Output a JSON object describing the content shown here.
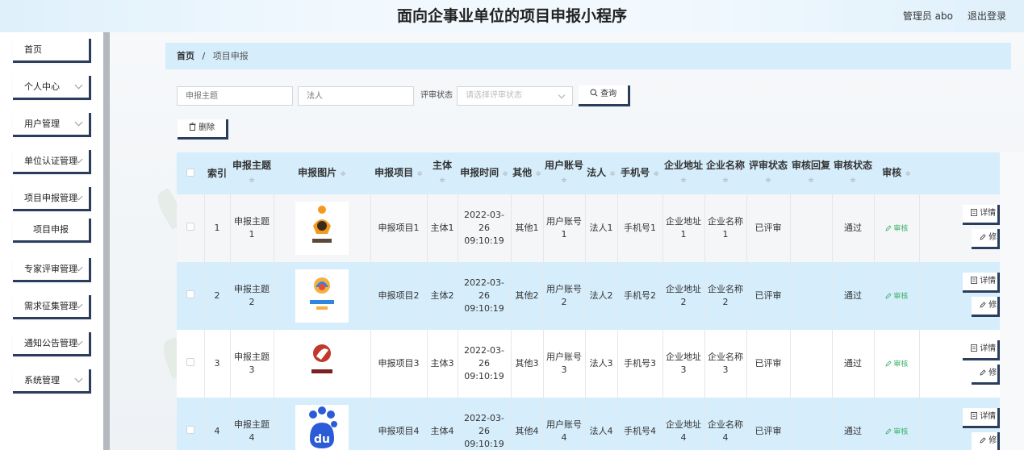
{
  "header": {
    "title": "面向企事业单位的项目申报小程序",
    "user": "管理员 abo",
    "logout": "退出登录"
  },
  "sidebar": {
    "items": [
      {
        "label": "首页",
        "has_chevron": false
      },
      {
        "label": "个人中心",
        "has_chevron": true
      },
      {
        "label": "用户管理",
        "has_chevron": true
      },
      {
        "label": "单位认证管理",
        "has_chevron": true
      },
      {
        "label": "项目申报管理",
        "has_chevron": true
      },
      {
        "label": "项目申报",
        "has_chevron": false,
        "sub": true
      },
      {
        "label": "专家评审管理",
        "has_chevron": true
      },
      {
        "label": "需求征集管理",
        "has_chevron": true
      },
      {
        "label": "通知公告管理",
        "has_chevron": true
      },
      {
        "label": "系统管理",
        "has_chevron": true
      }
    ]
  },
  "breadcrumb": {
    "home": "首页",
    "separator": "/",
    "current": "项目申报"
  },
  "filters": {
    "subject_placeholder": "申报主题",
    "legal_placeholder": "法人",
    "status_label": "评审状态",
    "status_placeholder": "请选择评审状态",
    "search_button": "查询"
  },
  "toolbar": {
    "delete_button": "删除"
  },
  "table": {
    "headers": {
      "index": "索引",
      "subject": "申报主题",
      "image": "申报图片",
      "project": "申报项目",
      "body": "主体",
      "time": "申报时间",
      "other": "其他",
      "account": "用户账号",
      "legal": "法人",
      "phone": "手机号",
      "address": "企业地址",
      "company": "企业名称",
      "review_status": "评审状态",
      "audit_reply": "审核回复",
      "audit_status": "审核状态",
      "audit": "审核"
    },
    "rows": [
      {
        "index": "1",
        "subject": "申报主题1",
        "project": "申报项目1",
        "body": "主体1",
        "time": "2022-03-26 09:10:19",
        "other": "其他1",
        "account": "用户账号1",
        "legal": "法人1",
        "phone": "手机号1",
        "address": "企业地址1",
        "company": "企业名称1",
        "review_status": "已评审",
        "audit_reply": "",
        "audit_status": "通过",
        "audit_link": "审核",
        "detail": "详情",
        "edit": "修改",
        "logo": "orange"
      },
      {
        "index": "2",
        "subject": "申报主题2",
        "project": "申报项目2",
        "body": "主体2",
        "time": "2022-03-26 09:10:19",
        "other": "其他2",
        "account": "用户账号2",
        "legal": "法人2",
        "phone": "手机号2",
        "address": "企业地址2",
        "company": "企业名称2",
        "review_status": "已评审",
        "audit_reply": "",
        "audit_status": "通过",
        "audit_link": "审核",
        "detail": "详情",
        "edit": "修改",
        "logo": "multi"
      },
      {
        "index": "3",
        "subject": "申报主题3",
        "project": "申报项目3",
        "body": "主体3",
        "time": "2022-03-26 09:10:19",
        "other": "其他3",
        "account": "用户账号3",
        "legal": "法人3",
        "phone": "手机号3",
        "address": "企业地址3",
        "company": "企业名称3",
        "review_status": "已评审",
        "audit_reply": "",
        "audit_status": "通过",
        "audit_link": "审核",
        "detail": "详情",
        "edit": "修改",
        "logo": "red"
      },
      {
        "index": "4",
        "subject": "申报主题4",
        "project": "申报项目4",
        "body": "主体4",
        "time": "2022-03-26 09:10:19",
        "other": "其他4",
        "account": "用户账号4",
        "legal": "法人4",
        "phone": "手机号4",
        "address": "企业地址4",
        "company": "企业名称4",
        "review_status": "已评审",
        "audit_reply": "",
        "audit_status": "通过",
        "audit_link": "审核",
        "detail": "详情",
        "edit": "修改",
        "logo": "baidu"
      }
    ]
  },
  "colors": {
    "accent_border": "#2b3d5c",
    "header_blue": "#d6edfb",
    "audit_green": "#3bb26a"
  },
  "icons": {
    "search": "search-icon",
    "delete": "trash-icon",
    "detail": "document-icon",
    "edit": "pencil-icon",
    "audit": "pencil-icon"
  }
}
